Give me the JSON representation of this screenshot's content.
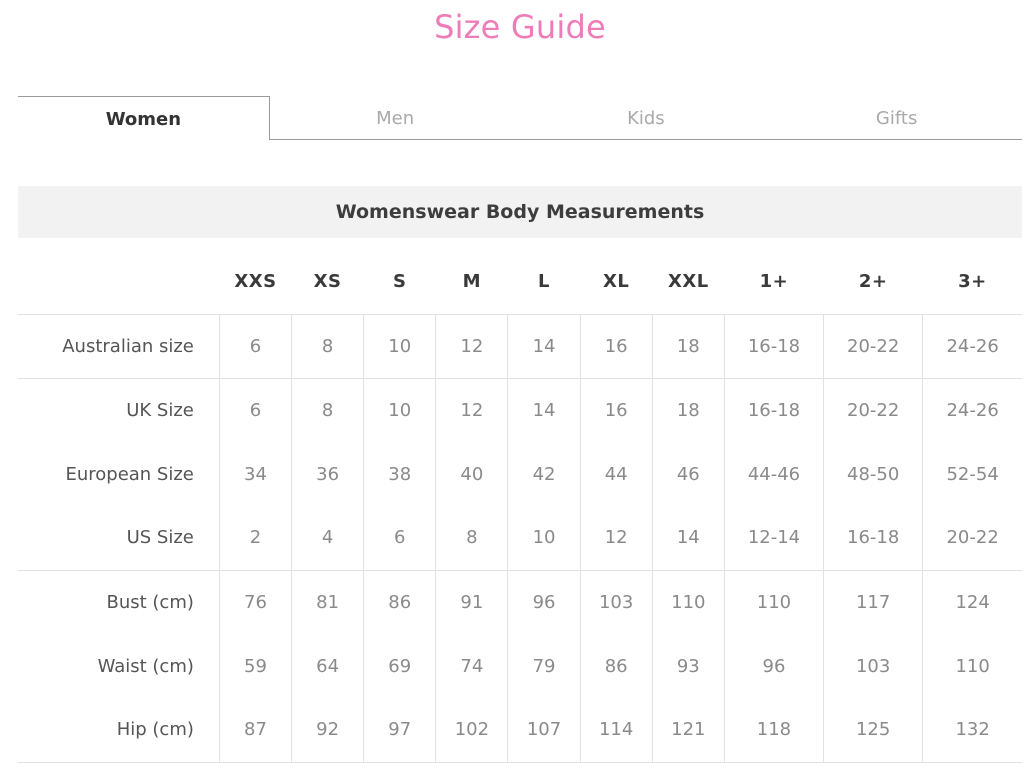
{
  "page": {
    "title": "Size Guide"
  },
  "tabs": [
    {
      "label": "Women",
      "active": true
    },
    {
      "label": "Men",
      "active": false
    },
    {
      "label": "Kids",
      "active": false
    },
    {
      "label": "Gifts",
      "active": false
    }
  ],
  "section": {
    "title": "Womenswear Body Measurements"
  },
  "table": {
    "columns": [
      "XXS",
      "XS",
      "S",
      "M",
      "L",
      "XL",
      "XXL",
      "1+",
      "2+",
      "3+"
    ],
    "rows": [
      {
        "label": "Australian size",
        "values": [
          "6",
          "8",
          "10",
          "12",
          "14",
          "16",
          "18",
          "16-18",
          "20-22",
          "24-26"
        ]
      },
      {
        "label": "UK Size",
        "values": [
          "6",
          "8",
          "10",
          "12",
          "14",
          "16",
          "18",
          "16-18",
          "20-22",
          "24-26"
        ]
      },
      {
        "label": "European Size",
        "values": [
          "34",
          "36",
          "38",
          "40",
          "42",
          "44",
          "46",
          "44-46",
          "48-50",
          "52-54"
        ]
      },
      {
        "label": "US Size",
        "values": [
          "2",
          "4",
          "6",
          "8",
          "10",
          "12",
          "14",
          "12-14",
          "16-18",
          "20-22"
        ]
      },
      {
        "label": "Bust (cm)",
        "values": [
          "76",
          "81",
          "86",
          "91",
          "96",
          "103",
          "110",
          "110",
          "117",
          "124"
        ]
      },
      {
        "label": "Waist (cm)",
        "values": [
          "59",
          "64",
          "69",
          "74",
          "79",
          "86",
          "93",
          "96",
          "103",
          "110"
        ]
      },
      {
        "label": "Hip (cm)",
        "values": [
          "87",
          "92",
          "97",
          "102",
          "107",
          "114",
          "121",
          "118",
          "125",
          "132"
        ]
      }
    ]
  },
  "colors": {
    "title": "#ee7cb9",
    "header_bg": "#f2f2f2",
    "grid": "#e2e2e2"
  }
}
